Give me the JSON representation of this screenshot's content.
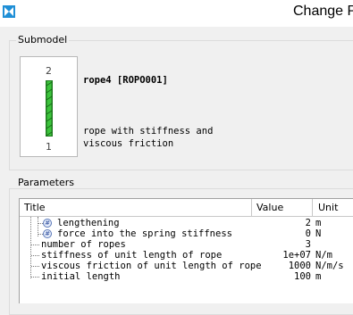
{
  "window": {
    "title": "Change P",
    "accent": "#1f8fd6"
  },
  "submodel": {
    "group_label": "Submodel",
    "preview": {
      "top_node": "2",
      "bottom_node": "1",
      "rope_color": "#2fb52f"
    },
    "name": "rope4 [ROPO001]",
    "description_lines": [
      "rope with stiffness and",
      "viscous friction"
    ]
  },
  "parameters": {
    "group_label": "Parameters",
    "columns": [
      "Title",
      "Value",
      "Unit"
    ],
    "rows": [
      {
        "icon": "#",
        "title": "lengthening",
        "value": "2",
        "unit": "m"
      },
      {
        "icon": "#",
        "title": "force into the spring stiffness",
        "value": "0",
        "unit": "N"
      },
      {
        "title": "number of ropes",
        "value": "3",
        "unit": ""
      },
      {
        "title": "stiffness of unit length of rope",
        "value": "1e+07",
        "unit": "N/m"
      },
      {
        "title": "viscous friction of unit length of rope",
        "value": "1000",
        "unit": "N/m/s"
      },
      {
        "title": "initial length",
        "value": "100",
        "unit": "m"
      }
    ]
  }
}
